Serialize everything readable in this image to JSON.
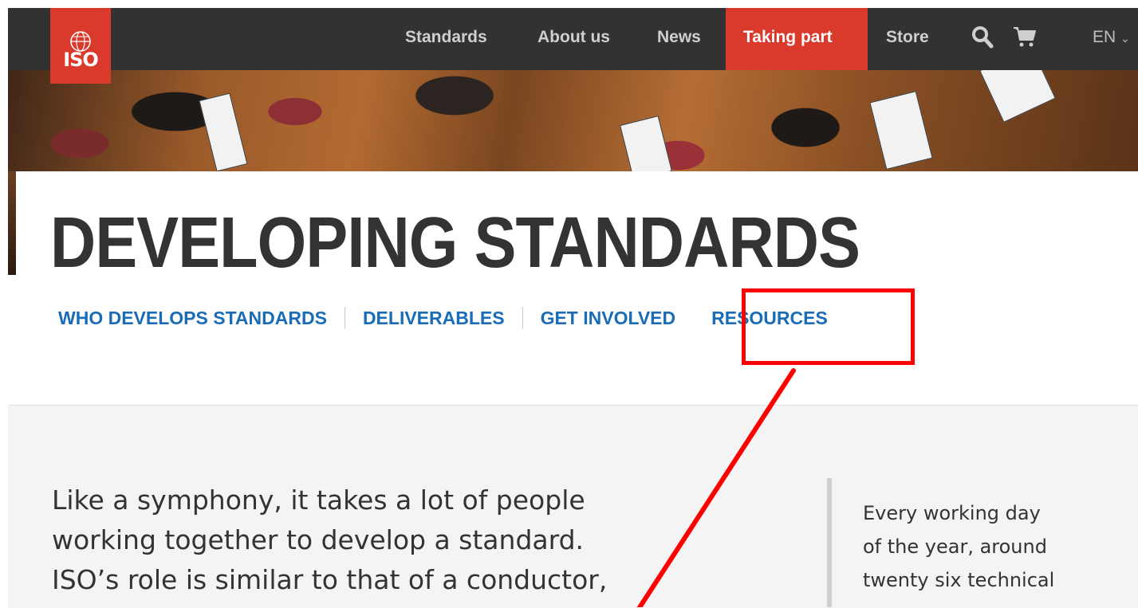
{
  "nav": {
    "logo_text": "ISO",
    "items": [
      {
        "label": "Standards"
      },
      {
        "label": "About us"
      },
      {
        "label": "News"
      },
      {
        "label": "Taking part",
        "active": true
      },
      {
        "label": "Store"
      }
    ],
    "search_icon": "search-icon",
    "cart_icon": "cart-icon",
    "language": "EN"
  },
  "page": {
    "title": "DEVELOPING STANDARDS",
    "subnav": [
      "WHO DEVELOPS STANDARDS",
      "DELIVERABLES",
      "GET INVOLVED",
      "RESOURCES"
    ]
  },
  "content": {
    "lead_lines": [
      "Like a symphony, it takes a lot of people",
      "working together to develop a standard.",
      "ISO’s role is similar to that of a conductor,"
    ],
    "side_lines": [
      "Every working day",
      "of the year, around",
      "twenty six technical"
    ]
  },
  "colors": {
    "nav_bg": "#323232",
    "accent_red": "#d93a2b",
    "link_blue": "#1a6cb7",
    "annotation_red": "#ff0000"
  }
}
